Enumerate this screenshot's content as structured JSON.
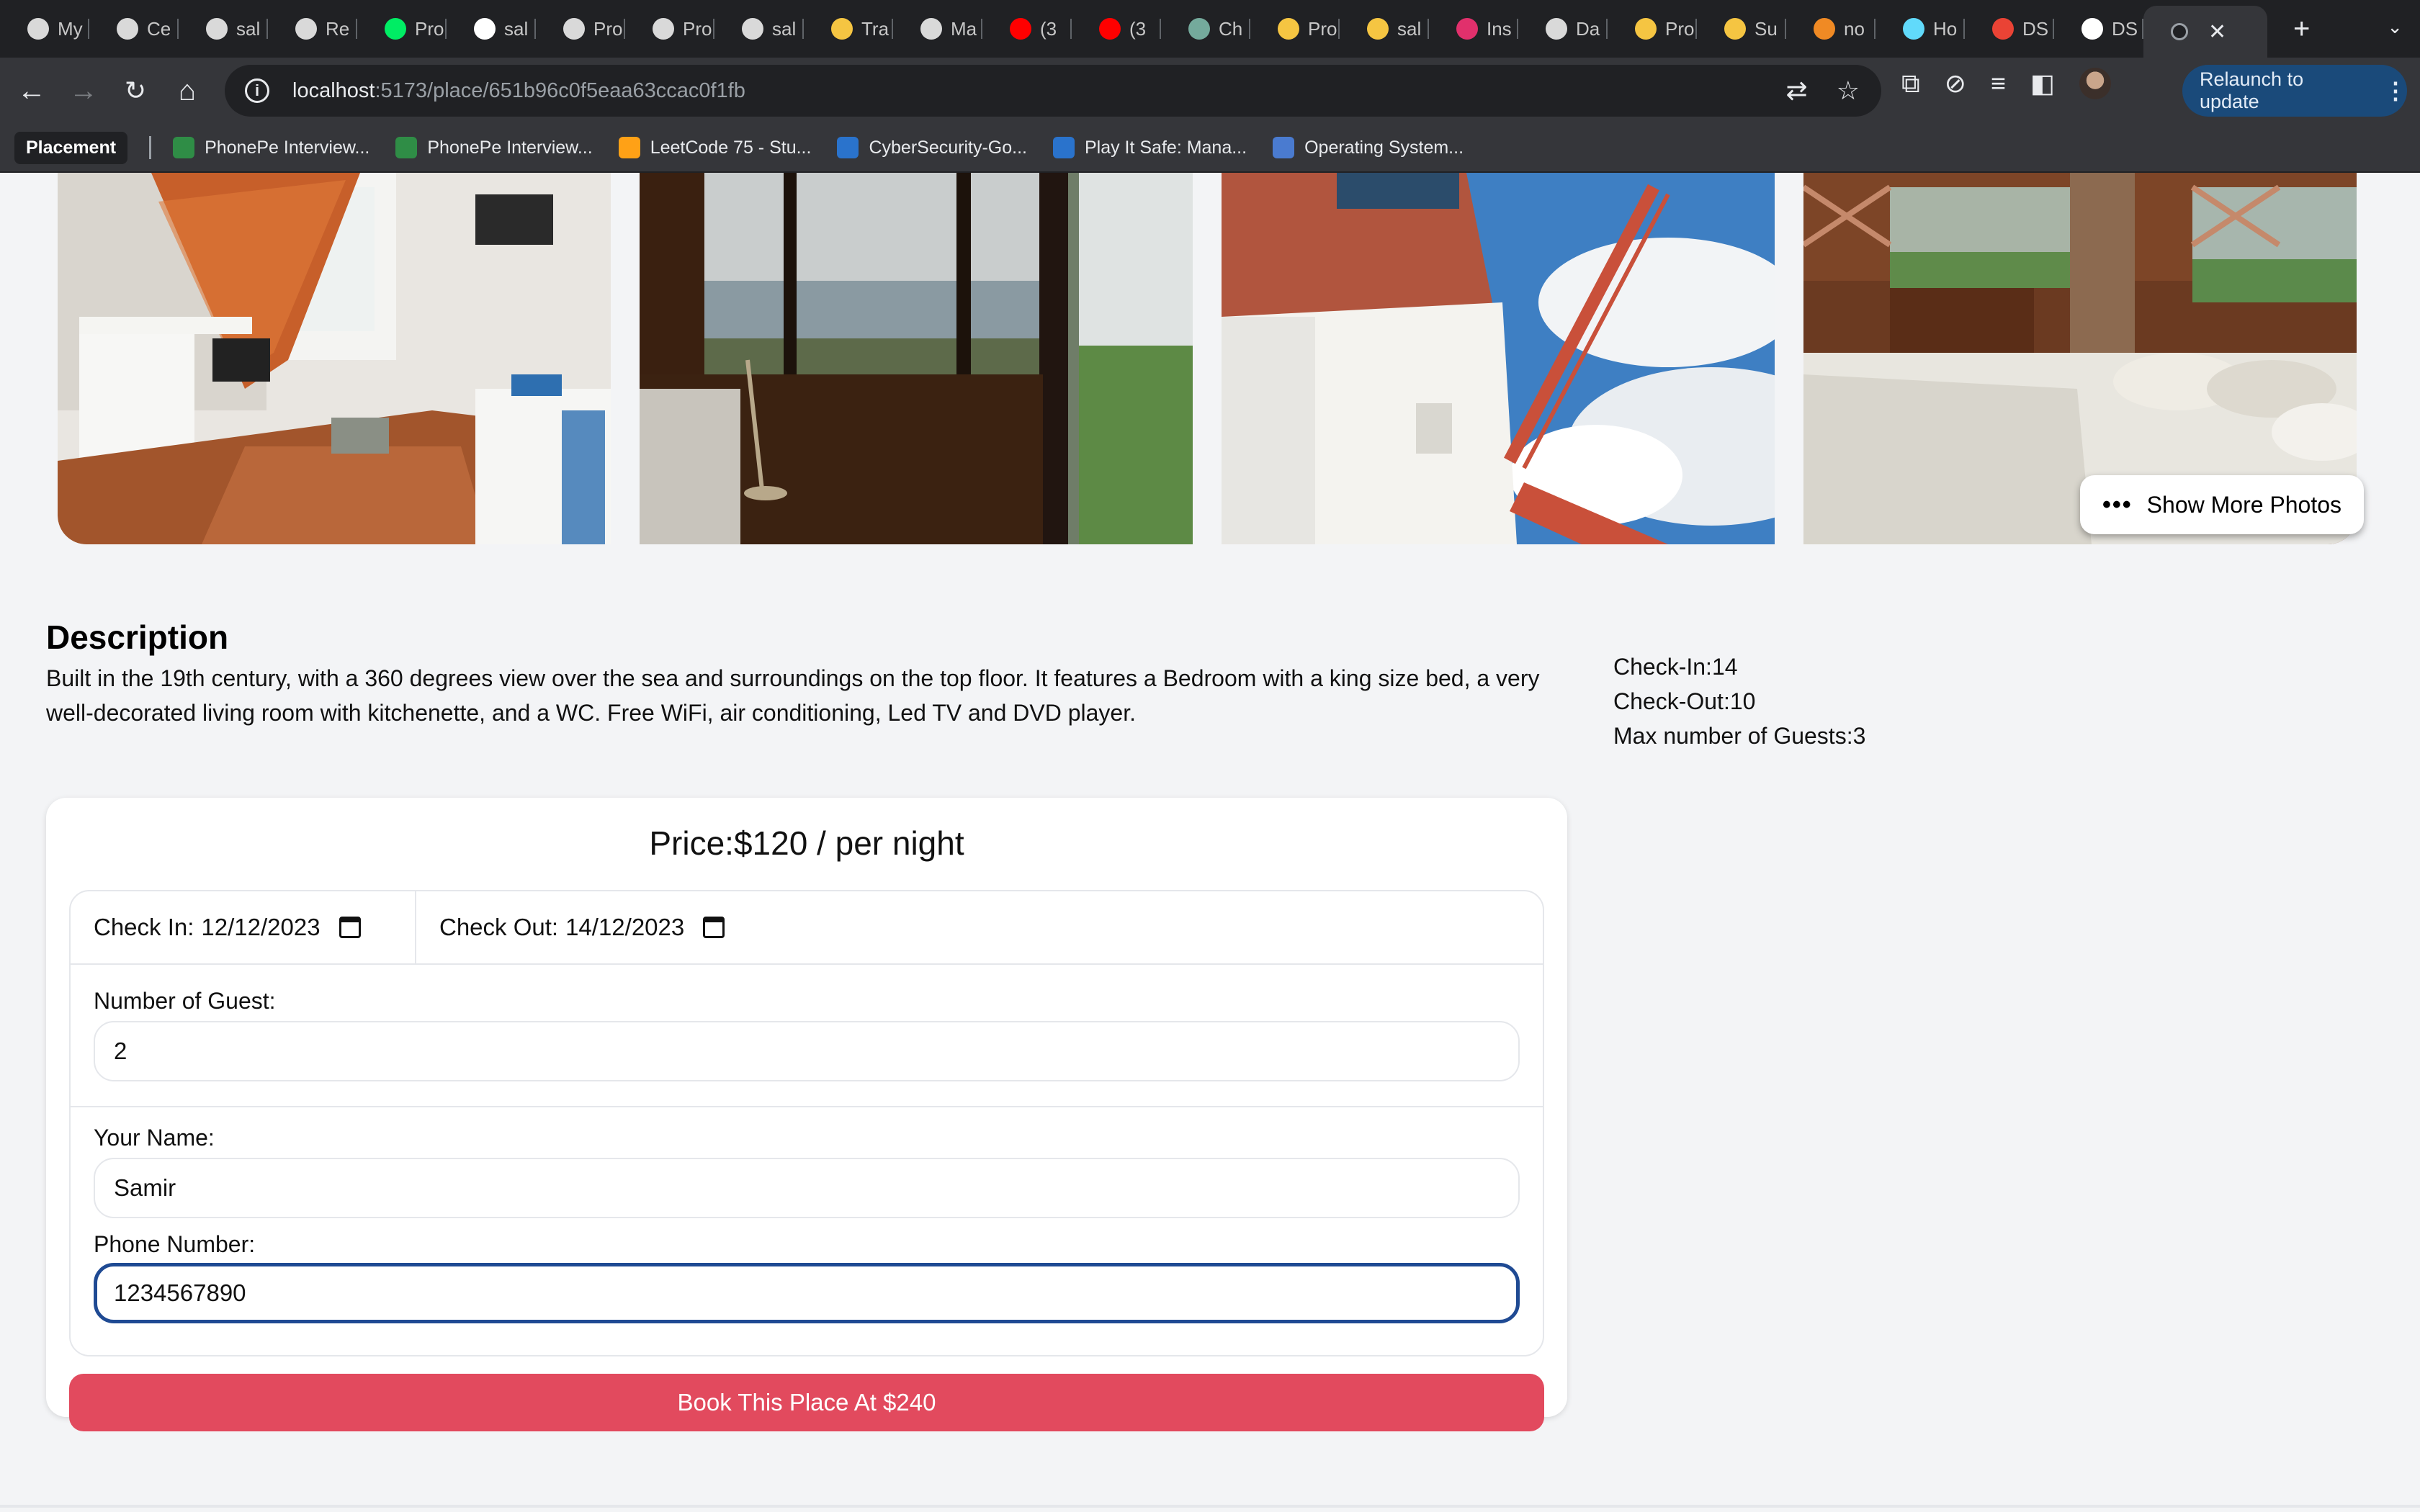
{
  "browser": {
    "tabs": [
      {
        "label": "My",
        "icon": "openai-icon",
        "color": "#d9d9d9"
      },
      {
        "label": "Ce",
        "icon": "openai-icon",
        "color": "#d9d9d9"
      },
      {
        "label": "sal",
        "icon": "loader-icon",
        "color": "#d9d9d9"
      },
      {
        "label": "Re",
        "icon": "loader-icon",
        "color": "#d9d9d9"
      },
      {
        "label": "Pro",
        "icon": "mongodb-leaf-icon",
        "color": "#00ed64"
      },
      {
        "label": "sal",
        "icon": "github-icon",
        "color": "#ffffff"
      },
      {
        "label": "Pro",
        "icon": "loader-icon",
        "color": "#d9d9d9"
      },
      {
        "label": "Pro",
        "icon": "loader-icon",
        "color": "#d9d9d9"
      },
      {
        "label": "sal",
        "icon": "loader-icon",
        "color": "#d9d9d9"
      },
      {
        "label": "Tra",
        "icon": "render-icon",
        "color": "#f5c542"
      },
      {
        "label": "Ma",
        "icon": "loader-icon",
        "color": "#d9d9d9"
      },
      {
        "label": "(3",
        "icon": "youtube-icon",
        "color": "#ff0000"
      },
      {
        "label": "(3",
        "icon": "youtube-icon",
        "color": "#ff0000"
      },
      {
        "label": "Ch",
        "icon": "chatgpt-icon",
        "color": "#74aa9c"
      },
      {
        "label": "Pro",
        "icon": "render-icon",
        "color": "#f5c542"
      },
      {
        "label": "sal",
        "icon": "render-icon",
        "color": "#f5c542"
      },
      {
        "label": "Ins",
        "icon": "instagram-icon",
        "color": "#e1306c"
      },
      {
        "label": "Da",
        "icon": "globe-icon",
        "color": "#d9d9d9"
      },
      {
        "label": "Pro",
        "icon": "render-icon",
        "color": "#f5c542"
      },
      {
        "label": "Su",
        "icon": "render-icon",
        "color": "#f5c542"
      },
      {
        "label": "no",
        "icon": "render-icon",
        "color": "#f08a24"
      },
      {
        "label": "Ho",
        "icon": "react-icon",
        "color": "#61dafb"
      },
      {
        "label": "DS",
        "icon": "gmail-icon",
        "color": "#ea4335"
      },
      {
        "label": "DS",
        "icon": "github-icon",
        "color": "#ffffff"
      }
    ],
    "address": {
      "host": "localhost",
      "path": ":5173/place/651b96c0f5eaa63ccac0f1fb"
    },
    "relaunch_label": "Relaunch to update",
    "bookmarks": {
      "folder": "Placement",
      "items": [
        {
          "label": "PhonePe Interview...",
          "icon": "gfg-icon",
          "color": "#2f8d46"
        },
        {
          "label": "PhonePe Interview...",
          "icon": "gfg-icon",
          "color": "#2f8d46"
        },
        {
          "label": "LeetCode 75 - Stu...",
          "icon": "leetcode-icon",
          "color": "#ffa116"
        },
        {
          "label": "CyberSecurity-Go...",
          "icon": "coursera-icon",
          "color": "#2a73cc"
        },
        {
          "label": "Play It Safe: Mana...",
          "icon": "coursera-icon",
          "color": "#2a73cc"
        },
        {
          "label": "Operating System...",
          "icon": "sp-icon",
          "color": "#4a7bd0"
        }
      ]
    }
  },
  "page": {
    "show_more_label": "Show More Photos",
    "description_title": "Description",
    "description": "Built in the 19th century, with a 360 degrees view over the sea and surroundings on the top floor. It features a Bedroom with a king size bed, a very well-decorated living room with kitchenette, and a WC. Free WiFi, air conditioning, Led TV and DVD player.",
    "facts": {
      "check_in": "Check-In:14",
      "check_out": "Check-Out:10",
      "max_guests": "Max number of Guests:3"
    },
    "booking": {
      "price": "Price:$120 / per night",
      "check_in_label": "Check In:",
      "check_in_value": "12/12/2023",
      "check_out_label": "Check Out:",
      "check_out_value": "14/12/2023",
      "guests_label": "Number of Guest:",
      "guests_value": "2",
      "name_label": "Your Name:",
      "name_value": "Samir",
      "phone_label": "Phone Number:",
      "phone_value": "1234567890",
      "button_label": "Book This Place At $240"
    },
    "colors": {
      "accent": "#e24a5e",
      "focus": "#1f4a93",
      "background": "#f3f4f6"
    }
  }
}
